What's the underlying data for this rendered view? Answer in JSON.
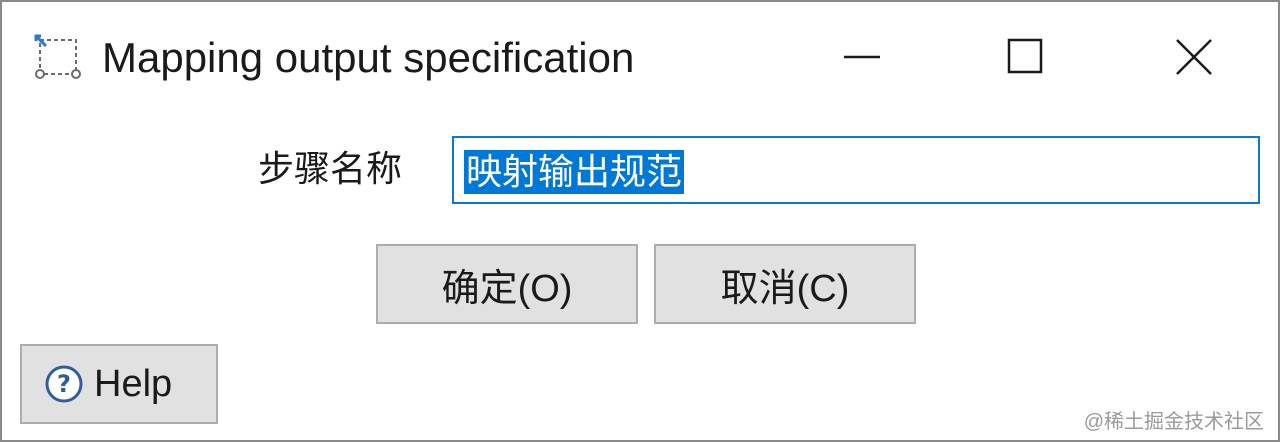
{
  "window": {
    "title": "Mapping output specification",
    "icon": "transform-step-icon",
    "controls": {
      "minimize_icon": "minimize-icon",
      "maximize_icon": "maximize-icon",
      "close_icon": "close-icon"
    }
  },
  "form": {
    "step_name_label": "步骤名称",
    "step_name_value": "映射输出规范"
  },
  "buttons": {
    "ok_label": "确定(O)",
    "cancel_label": "取消(C)",
    "help_label": "Help",
    "help_icon": "help-circle-icon"
  },
  "watermark": "@稀土掘金技术社区",
  "colors": {
    "selection": "#0078d7",
    "input_border": "#0a78d7",
    "button_face": "#e1e1e1"
  }
}
